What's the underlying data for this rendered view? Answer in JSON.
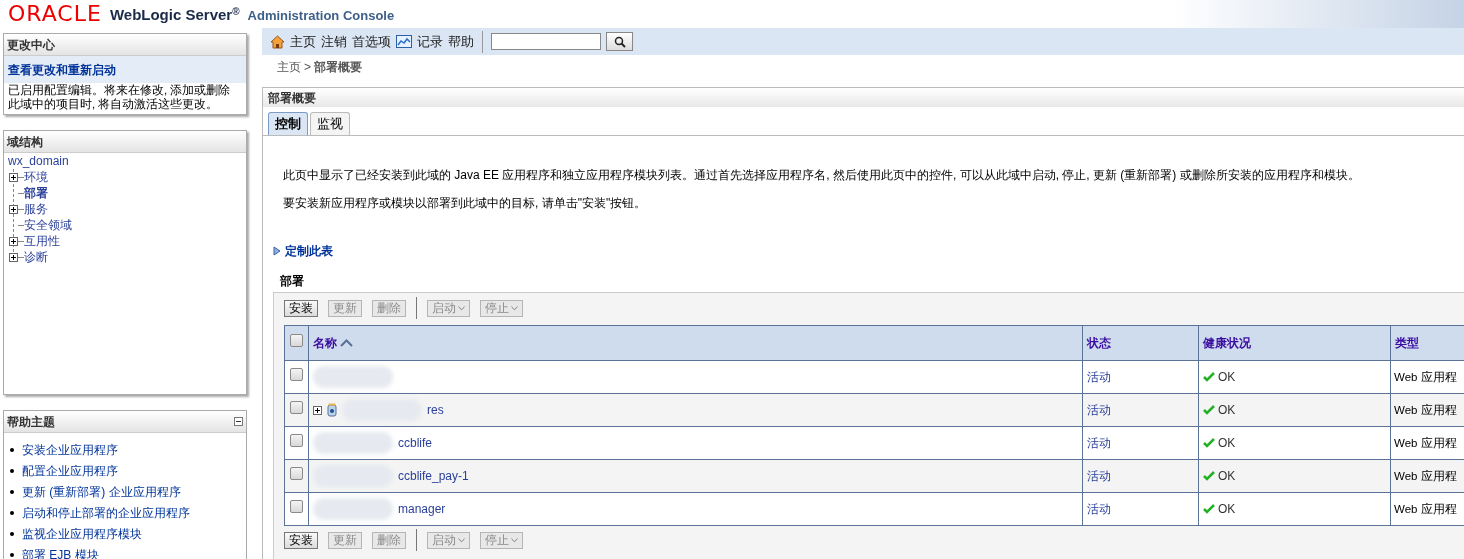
{
  "header": {
    "brand": "ORACLE",
    "product": "WebLogic Server",
    "registered": "®",
    "subtitle": "Administration Console"
  },
  "change_center": {
    "title": "更改中心",
    "link": "查看更改和重新启动",
    "message": "已启用配置编辑。将来在修改, 添加或删除此域中的项目时, 将自动激活这些更改。"
  },
  "domain_structure": {
    "title": "域结构",
    "root": "wx_domain",
    "children": [
      {
        "label": "环境",
        "expandable": true,
        "selected": false
      },
      {
        "label": "部署",
        "expandable": false,
        "selected": true
      },
      {
        "label": "服务",
        "expandable": true,
        "selected": false
      },
      {
        "label": "安全领域",
        "expandable": false,
        "selected": false
      },
      {
        "label": "互用性",
        "expandable": true,
        "selected": false
      },
      {
        "label": "诊断",
        "expandable": true,
        "selected": false
      }
    ]
  },
  "help_topics": {
    "title": "帮助主题",
    "items": [
      "安装企业应用程序",
      "配置企业应用程序",
      "更新 (重新部署) 企业应用程序",
      "启动和停止部署的企业应用程序",
      "监视企业应用程序模块",
      "部署 EJB 模块"
    ]
  },
  "toolbar": {
    "items": [
      {
        "kind": "home",
        "label": "主页"
      },
      {
        "kind": "text",
        "label": "注销"
      },
      {
        "kind": "text",
        "label": "首选项"
      },
      {
        "kind": "chart",
        "label": "记录"
      },
      {
        "kind": "text",
        "label": "帮助"
      }
    ]
  },
  "breadcrumb": {
    "home": "主页",
    "separator": ">",
    "current": "部署概要"
  },
  "panel": {
    "title": "部署概要",
    "tabs": [
      {
        "label": "控制",
        "selected": true
      },
      {
        "label": "监视",
        "selected": false
      }
    ],
    "paragraphs": [
      "此页中显示了已经安装到此域的 Java EE 应用程序和独立应用程序模块列表。通过首先选择应用程序名, 然后使用此页中的控件, 可以从此域中启动, 停止, 更新 (重新部署) 或删除所安装的应用程序和模块。",
      "要安装新应用程序或模块以部署到此域中的目标, 请单击\"安装\"按钮。"
    ],
    "customize": "定制此表",
    "table_title": "部署",
    "buttons": [
      {
        "label": "安装",
        "disabled": false,
        "dropdown": false
      },
      {
        "label": "更新",
        "disabled": true,
        "dropdown": false
      },
      {
        "label": "删除",
        "disabled": true,
        "dropdown": false
      },
      {
        "label": "启动",
        "disabled": true,
        "dropdown": true
      },
      {
        "label": "停止",
        "disabled": true,
        "dropdown": true
      }
    ],
    "buttons_bottom": [
      {
        "label": "安装",
        "disabled": false,
        "dropdown": false
      },
      {
        "label": "更新",
        "disabled": true,
        "dropdown": false
      },
      {
        "label": "删除",
        "disabled": true,
        "dropdown": false
      },
      {
        "label": "启动",
        "disabled": true,
        "dropdown": true
      },
      {
        "label": "停止",
        "disabled": true,
        "dropdown": true
      }
    ],
    "select_all_checked": false,
    "columns": [
      "名称",
      "状态",
      "健康状况",
      "类型"
    ],
    "rows": [
      {
        "expandable": false,
        "checked": false,
        "status": "活动",
        "health": "OK",
        "type": "Web 应用程"
      },
      {
        "name": "res",
        "expandable": true,
        "checked": false,
        "status": "活动",
        "health": "OK",
        "type": "Web 应用程"
      },
      {
        "name": "ccblife",
        "expandable": false,
        "checked": false,
        "status": "活动",
        "health": "OK",
        "type": "Web 应用程"
      },
      {
        "name": "ccblife_pay-1",
        "expandable": false,
        "checked": false,
        "status": "活动",
        "health": "OK",
        "type": "Web 应用程"
      },
      {
        "name": "manager",
        "expandable": false,
        "checked": false,
        "status": "活动",
        "health": "OK",
        "type": "Web 应用程"
      }
    ]
  }
}
